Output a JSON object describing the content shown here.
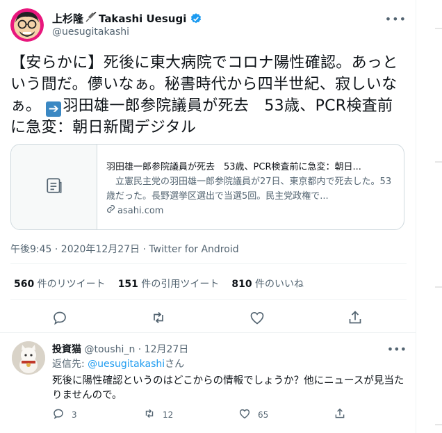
{
  "tweet": {
    "author": {
      "name": "上杉隆",
      "name_suffix": "Takashi Uesugi",
      "handle": "@uesugitakashi"
    },
    "text_main": "【安らかに】死後に東大病院でコロナ陽性確認。あっという間だ。儚いなぁ。秘書時代から四半世紀、寂しいなぁ。",
    "text_link": "羽田雄一郎参院議員が死去　53歳、PCR検査前に急変：朝日新聞デジタル",
    "card": {
      "title": "羽田雄一郎参院議員が死去　53歳、PCR検査前に急変：朝日...",
      "description": "　立憲民主党の羽田雄一郎参院議員が27日、東京都内で死去した。53歳だった。長野選挙区選出で当選5回。民主党政権で...",
      "domain": "asahi.com"
    },
    "meta": "午後9:45 · 2020年12月27日 · Twitter for Android",
    "stats": [
      {
        "count": "560",
        "label": " 件のリツイート"
      },
      {
        "count": "151",
        "label": " 件の引用ツイート"
      },
      {
        "count": "810",
        "label": " 件のいいね"
      }
    ]
  },
  "reply": {
    "name": "投資猫",
    "handle": "@toushi_n",
    "date": "12月27日",
    "replying_prefix": "返信先: ",
    "replying_mention": "@uesugitakashi",
    "replying_suffix": "さん",
    "text": "死後に陽性確認というのはどこからの情報でしょうか？他にニュースが見当たりませんので。",
    "counts": {
      "reply": "3",
      "retweet": "12",
      "like": "65"
    }
  },
  "colors": {
    "accent": "#1d9bf0",
    "muted": "#536471",
    "border": "#cfd9de",
    "verified": "#1d9bf0"
  }
}
